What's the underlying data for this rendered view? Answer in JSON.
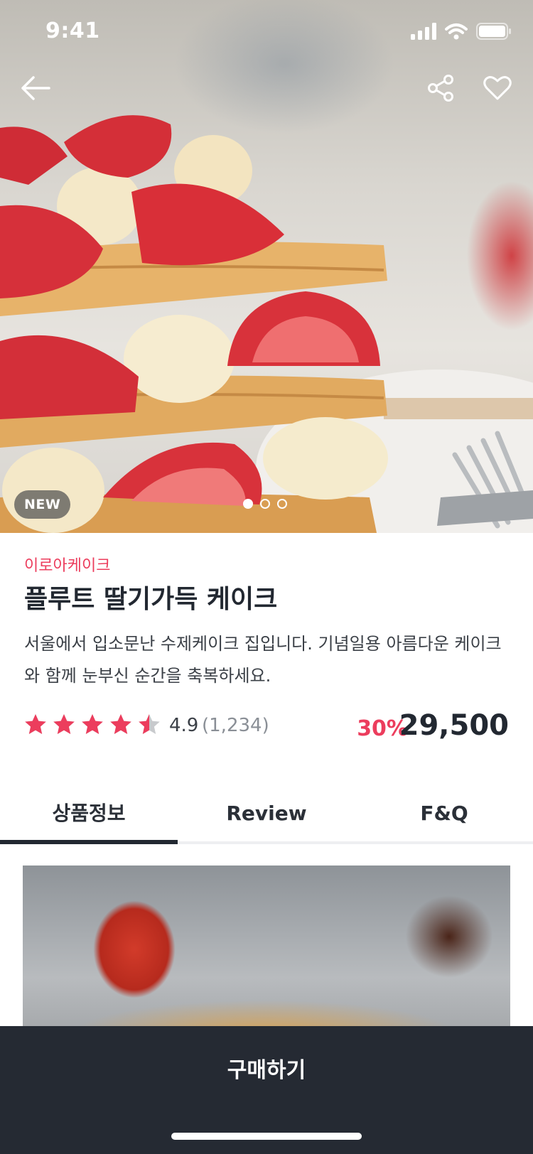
{
  "status_bar": {
    "time": "9:41"
  },
  "hero": {
    "badge": "NEW",
    "carousel": {
      "total": 3,
      "active": 1
    }
  },
  "product": {
    "shop_name": "이로아케이크",
    "title": "플루트 딸기가득 케이크",
    "description": "서울에서 입소문난 수제케이크 집입니다. 기념일용 아름다운 케이크와 함께 눈부신 순간을 축복하세요.",
    "rating": "4.9",
    "rating_value": 4.5,
    "review_count": "(1,234)",
    "discount": "30%",
    "price": "29,500"
  },
  "tabs": [
    "상품정보",
    "Review",
    "F&Q"
  ],
  "active_tab": 0,
  "cta": {
    "label": "구매하기"
  },
  "colors": {
    "accent": "#ec3d5d",
    "dark": "#222831",
    "bar": "#252a33",
    "star_empty": "#c8cacd"
  },
  "icons": [
    "back-arrow-icon",
    "share-icon",
    "heart-icon",
    "signal-icon",
    "wifi-icon",
    "battery-icon",
    "star-icon"
  ]
}
